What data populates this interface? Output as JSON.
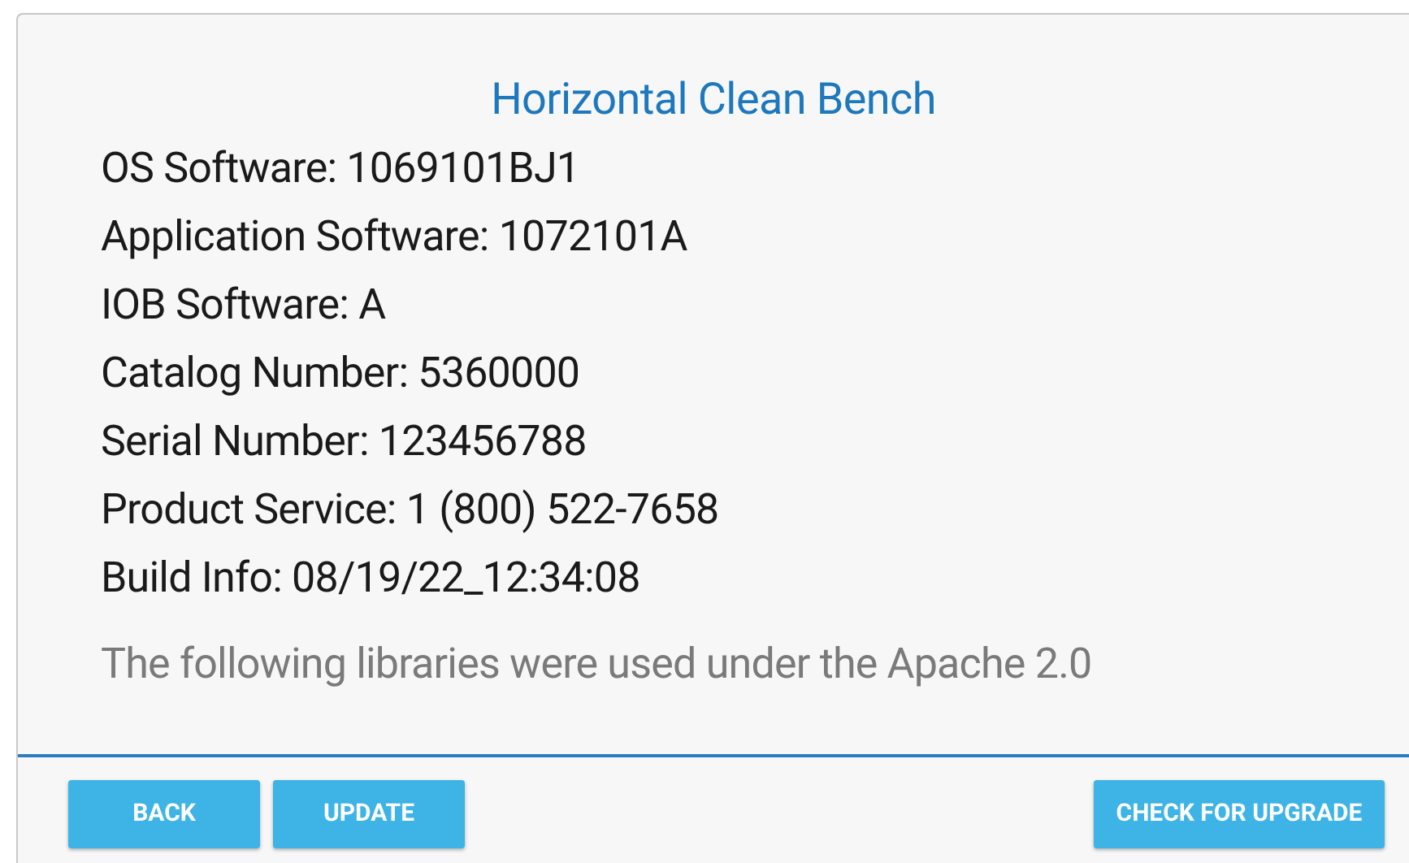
{
  "title": "Horizontal Clean Bench",
  "info_lines": [
    "OS Software: 1069101BJ1",
    "Application Software: 1072101A",
    "IOB Software: A",
    "Catalog Number: 5360000",
    "Serial Number: 123456788",
    "Product Service: 1 (800) 522-7658",
    "Build Info: 08/19/22_12:34:08"
  ],
  "notice": "The following libraries were used under the Apache 2.0",
  "buttons": {
    "left": [
      "BACK",
      "UPDATE"
    ],
    "right": [
      "CHECK FOR UPGRADE"
    ]
  }
}
